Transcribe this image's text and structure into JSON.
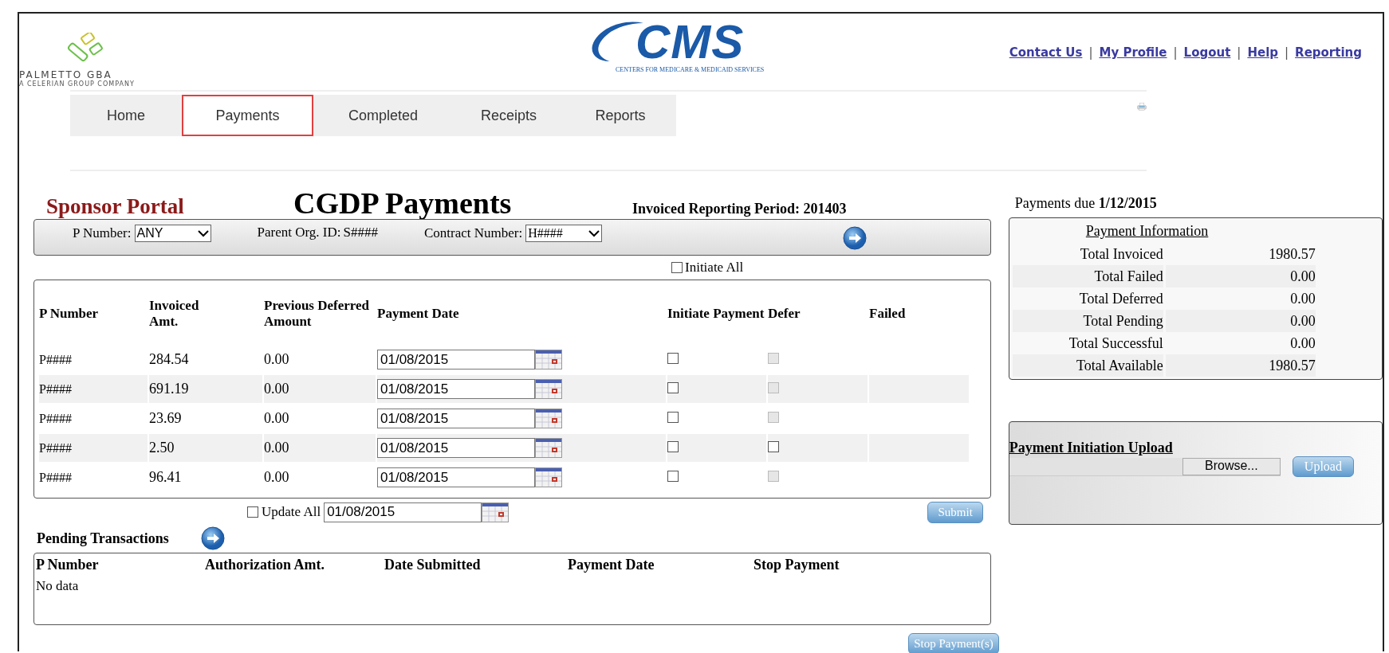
{
  "header": {
    "logo": {
      "name": "PALMETTO GBA",
      "tagline": "A CELERIAN GROUP COMPANY"
    },
    "cms_logo": {
      "name": "CMS",
      "subtitle": "CENTERS FOR MEDICARE & MEDICAID SERVICES"
    },
    "links": [
      "Contact Us",
      "My Profile",
      "Logout",
      "Help",
      "Reporting"
    ],
    "separators": [
      "|",
      "|",
      "|",
      "|"
    ]
  },
  "tabs": [
    {
      "label": "Home",
      "selected": false
    },
    {
      "label": "Payments",
      "selected": true
    },
    {
      "label": "Completed",
      "selected": false
    },
    {
      "label": "Receipts",
      "selected": false
    },
    {
      "label": "Reports",
      "selected": false
    }
  ],
  "page": {
    "portal": "Sponsor Portal",
    "title": "CGDP Payments",
    "period": "Invoiced Reporting Period: 201403"
  },
  "filters": [
    {
      "label": "P Number:",
      "value": "ANY",
      "kind": "select"
    },
    {
      "label": "Parent Org. ID:",
      "value": "S####",
      "kind": "text"
    },
    {
      "label": "Contract Number:",
      "value": "H####",
      "kind": "select"
    }
  ],
  "initiate_all": {
    "label": "Initiate All",
    "checked": false
  },
  "payments_table": {
    "columns": [
      "P Number",
      "Invoiced Amt.",
      "Previous Deferred Amount",
      "Payment Date",
      "Initiate Payment",
      "Defer",
      "Failed"
    ],
    "rows": [
      {
        "p_number": "P####",
        "invoiced": "284.54",
        "deferred": "0.00",
        "payment_date": "01/08/2015",
        "initiate": false,
        "defer": false,
        "defer_disabled": true
      },
      {
        "p_number": "P####",
        "invoiced": "691.19",
        "deferred": "0.00",
        "payment_date": "01/08/2015",
        "initiate": false,
        "defer": false,
        "defer_disabled": true
      },
      {
        "p_number": "P####",
        "invoiced": "23.69",
        "deferred": "0.00",
        "payment_date": "01/08/2015",
        "initiate": false,
        "defer": false,
        "defer_disabled": true
      },
      {
        "p_number": "P####",
        "invoiced": "2.50",
        "deferred": "0.00",
        "payment_date": "01/08/2015",
        "initiate": false,
        "defer": false,
        "defer_disabled": false
      },
      {
        "p_number": "P####",
        "invoiced": "96.41",
        "deferred": "0.00",
        "payment_date": "01/08/2015",
        "initiate": false,
        "defer": false,
        "defer_disabled": true
      }
    ]
  },
  "update_all": {
    "label": "Update All",
    "checked": false,
    "date": "01/08/2015"
  },
  "submit_button": "Submit",
  "pending": {
    "title": "Pending Transactions",
    "columns": [
      "P Number",
      "Authorization Amt.",
      "Date Submitted",
      "Payment Date",
      "Stop Payment"
    ],
    "empty": "No data"
  },
  "stop_button": "Stop Payment(s)",
  "due": "Payments due **1/12/2015**",
  "payment_info": {
    "title": "Payment Information",
    "rows": [
      {
        "label": "Total Invoiced",
        "value": "1980.57"
      },
      {
        "label": "Total Failed",
        "value": "0.00"
      },
      {
        "label": "Total Deferred",
        "value": "0.00"
      },
      {
        "label": "Total Pending",
        "value": "0.00"
      },
      {
        "label": "Total Successful",
        "value": "0.00"
      },
      {
        "label": "Total Available",
        "value": "1980.57"
      }
    ]
  },
  "upload": {
    "title": "Payment Initiation Upload",
    "browse": "Browse...",
    "button": "Upload"
  }
}
